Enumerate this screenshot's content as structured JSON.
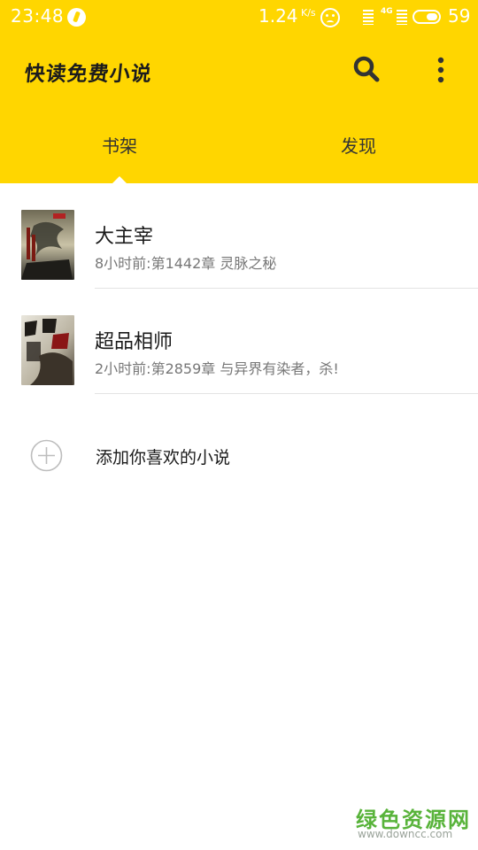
{
  "status_bar": {
    "time": "23:48",
    "net_speed": "1.24",
    "net_speed_unit": "K/s",
    "network": "4G",
    "battery": "59"
  },
  "app_bar": {
    "title": "快读免费小说",
    "search_icon": "search-icon",
    "more_icon": "more-vert-icon"
  },
  "tabs": [
    {
      "label": "书架",
      "selected": true
    },
    {
      "label": "发现",
      "selected": false
    }
  ],
  "books": [
    {
      "title": "大主宰",
      "subtitle": "8小时前:第1442章 灵脉之秘"
    },
    {
      "title": "超品相师",
      "subtitle": "2小时前:第2859章 与异界有染者，杀!"
    }
  ],
  "add_novel": {
    "label": "添加你喜欢的小说",
    "icon": "add-circle-icon"
  },
  "watermark": {
    "title": "绿色资源网",
    "url": "www.downcc.com"
  },
  "colors": {
    "accent": "#FFD600",
    "watermark": "#58b33a"
  }
}
